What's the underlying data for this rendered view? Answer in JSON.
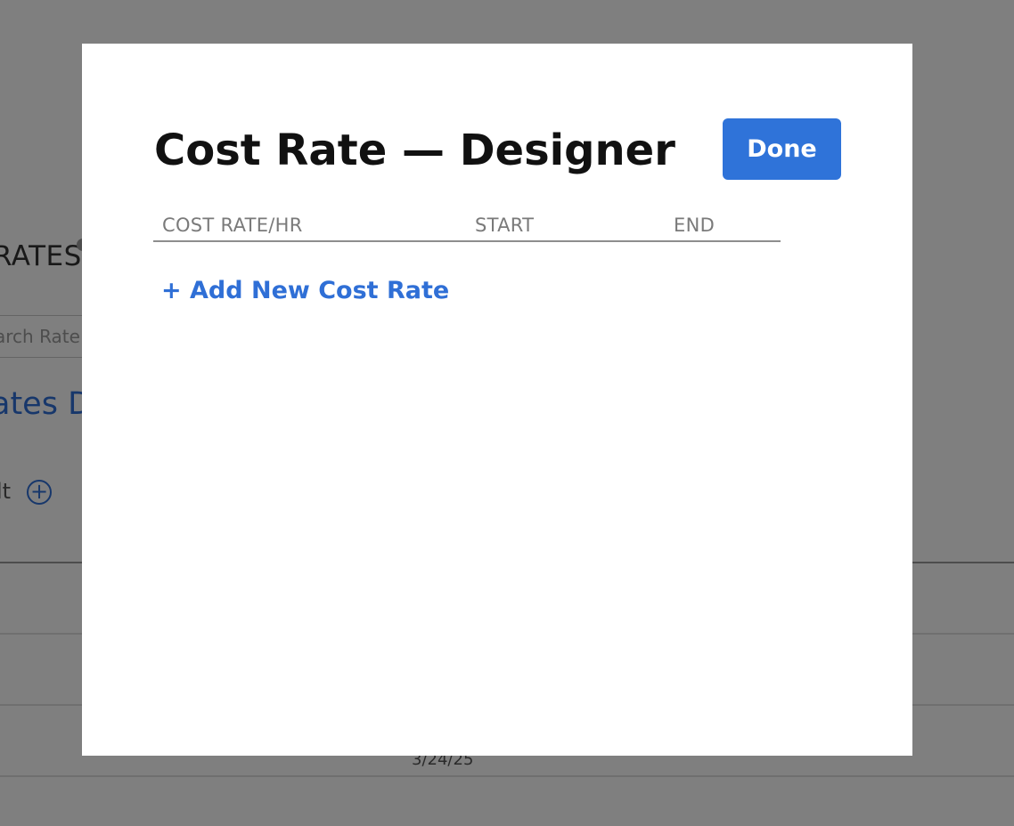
{
  "background": {
    "section_title": "RATES",
    "search_placeholder": "arch Rate",
    "link_text": "ates D",
    "default_label": "lt",
    "add_glyph": "+",
    "row_date": "3/24/25"
  },
  "modal": {
    "title": "Cost Rate — Designer",
    "done_label": "Done",
    "columns": [
      "COST RATE/HR",
      "START",
      "END"
    ],
    "add_link": "+ Add New Cost Rate"
  },
  "colors": {
    "accent": "#2f73d9",
    "link": "#2f6fd6",
    "overlay": "rgba(0,0,0,0.5)"
  }
}
